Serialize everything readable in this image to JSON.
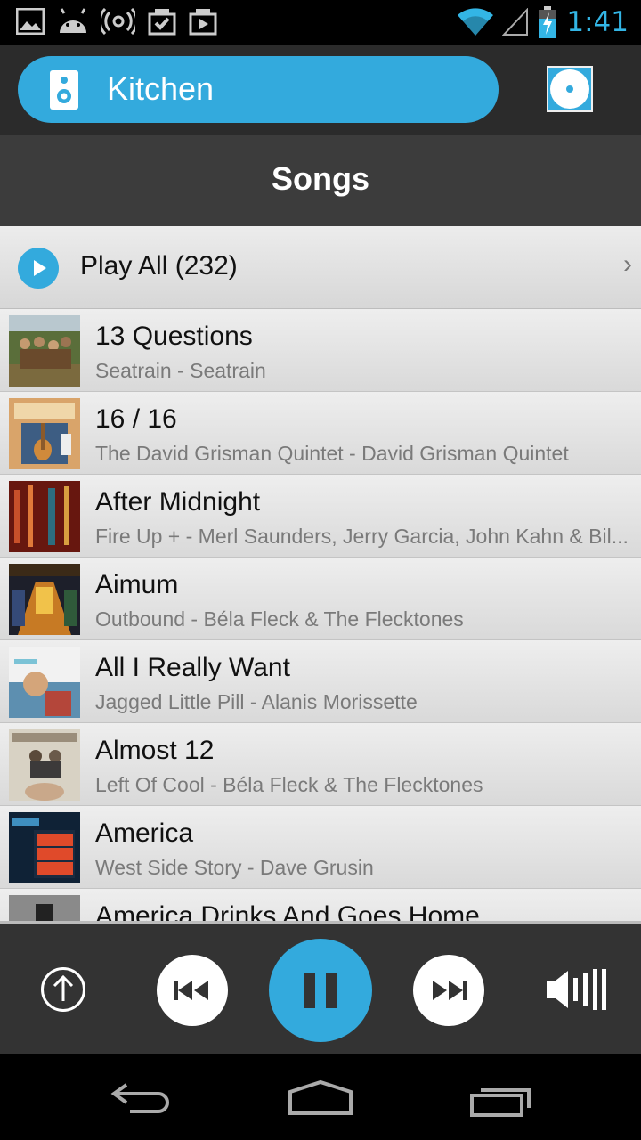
{
  "status_bar": {
    "time": "1:41",
    "icons": [
      "image-icon",
      "android-icon",
      "wireless-icon",
      "download-check-icon",
      "download-play-icon",
      "wifi-icon",
      "signal-icon",
      "battery-charging-icon"
    ]
  },
  "room": {
    "label": "Kitchen",
    "icon": "speaker-icon",
    "action_icon": "disc-icon"
  },
  "page": {
    "title": "Songs"
  },
  "play_all": {
    "label": "Play All (232)"
  },
  "songs": [
    {
      "title": "13 Questions",
      "subtitle": "Seatrain - Seatrain"
    },
    {
      "title": "16 / 16",
      "subtitle": "The David Grisman Quintet - David Grisman Quintet"
    },
    {
      "title": "After Midnight",
      "subtitle": "Fire Up + - Merl Saunders, Jerry Garcia, John Kahn & Bil..."
    },
    {
      "title": "Aimum",
      "subtitle": "Outbound - Béla Fleck & The Flecktones"
    },
    {
      "title": "All I Really Want",
      "subtitle": "Jagged Little Pill - Alanis Morissette"
    },
    {
      "title": "Almost 12",
      "subtitle": "Left Of Cool - Béla Fleck & The Flecktones"
    },
    {
      "title": "America",
      "subtitle": "West Side Story - Dave Grusin"
    },
    {
      "title": "America Drinks And Goes Home",
      "subtitle": ""
    }
  ],
  "controls": [
    "queue-up-icon",
    "previous-icon",
    "pause-icon",
    "next-icon",
    "volume-icon"
  ],
  "nav": [
    "back-icon",
    "home-icon",
    "recents-icon"
  ],
  "colors": {
    "accent": "#33aadd"
  }
}
